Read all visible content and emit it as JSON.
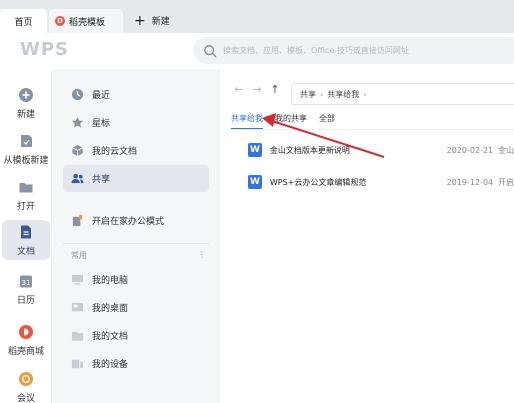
{
  "tabs": {
    "home": "首页",
    "docer": "稻壳模板",
    "new": "新建"
  },
  "header": {
    "logo": "WPS",
    "search_placeholder": "搜索文档、应用、模板、Office 技巧或直接访问网址"
  },
  "rail": {
    "items": [
      {
        "label": "新建",
        "icon": "plus-circle-icon"
      },
      {
        "label": "从模板新建",
        "icon": "template-icon"
      },
      {
        "label": "打开",
        "icon": "folder-icon"
      },
      {
        "label": "文档",
        "icon": "document-icon"
      },
      {
        "label": "日历",
        "icon": "calendar-icon"
      },
      {
        "label": "稻壳商城",
        "icon": "docer-store-icon"
      },
      {
        "label": "会议",
        "icon": "meeting-icon"
      }
    ]
  },
  "nav": {
    "items": [
      {
        "label": "最近",
        "icon": "clock-icon"
      },
      {
        "label": "星标",
        "icon": "star-icon"
      },
      {
        "label": "我的云文档",
        "icon": "cloud-doc-icon"
      },
      {
        "label": "共享",
        "icon": "share-users-icon"
      },
      {
        "label": "开启在家办公模式",
        "icon": "home-office-icon"
      }
    ],
    "section_label": "常用",
    "section_more": "⋮",
    "common": [
      {
        "label": "我的电脑",
        "icon": "computer-icon"
      },
      {
        "label": "我的桌面",
        "icon": "desktop-icon"
      },
      {
        "label": "我的文档",
        "icon": "my-docs-icon"
      },
      {
        "label": "我的设备",
        "icon": "device-icon"
      }
    ]
  },
  "main": {
    "breadcrumb": [
      "共享",
      "共享给我"
    ],
    "subtabs": [
      "共享给我",
      "我的共享",
      "全部"
    ],
    "files": [
      {
        "icon_letter": "W",
        "name": "金山文档版本更新说明",
        "date": "2020-02-21",
        "owner": "金山"
      },
      {
        "icon_letter": "W",
        "name": "WPS+云办公文章编辑规范",
        "date": "2019-12-04",
        "owner": "开启"
      }
    ]
  },
  "colors": {
    "accent": "#3672e6",
    "annotation_arrow": "#d9272e",
    "docer_brand": "#f0553b"
  }
}
